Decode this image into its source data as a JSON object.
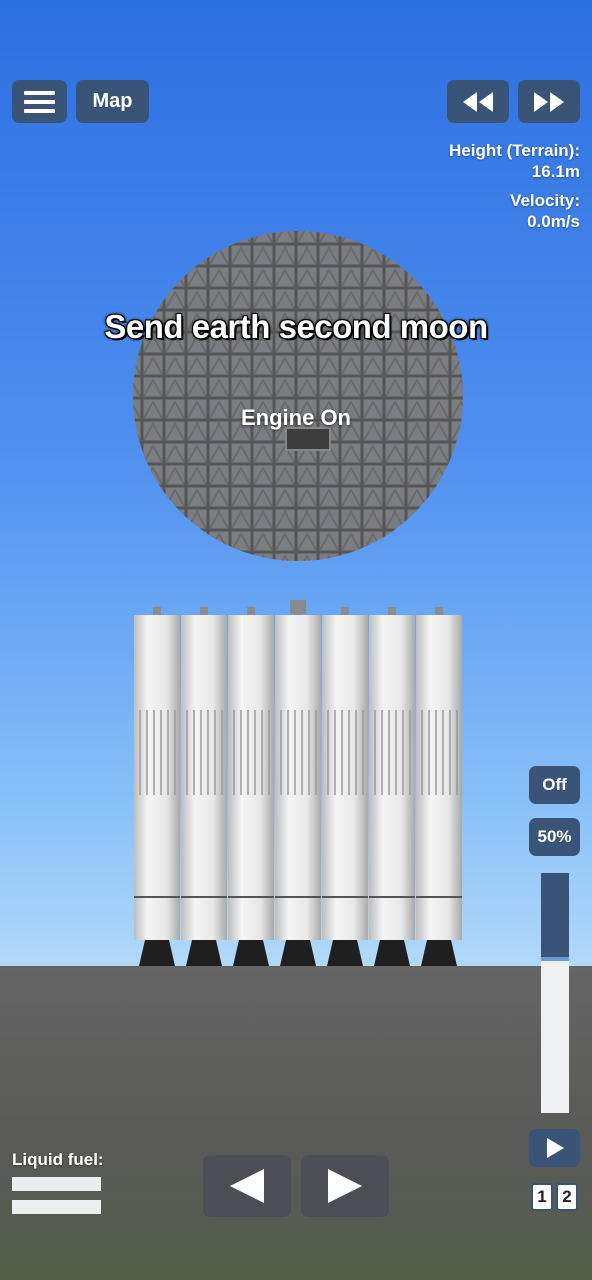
{
  "hud": {
    "map_label": "Map",
    "height_label": "Height (Terrain):",
    "height_value": "16.1m",
    "velocity_label": "Velocity:",
    "velocity_value": "0.0m/s"
  },
  "overlay": {
    "caption": "Send earth second moon",
    "status_message": "Engine On"
  },
  "engine_controls": {
    "toggle_label": "Off",
    "throttle_label": "50%",
    "throttle_level": 0.64
  },
  "stage": {
    "digits": [
      "1",
      "2"
    ]
  },
  "fuel": {
    "label": "Liquid fuel:",
    "tanks_full": [
      1.0,
      1.0
    ]
  },
  "colors": {
    "button_bg": "#3a5478",
    "sky_top": "#2c6fe0",
    "ground": "#5a5a58",
    "truss": "#5c5c5c",
    "tank": "#e4e4e4"
  },
  "icons": {
    "menu": "hamburger-icon",
    "rewind": "rewind-icon",
    "fast_forward": "fast-forward-icon",
    "play": "play-icon",
    "rotate_left": "left-arrow-icon",
    "rotate_right": "right-arrow-icon"
  }
}
